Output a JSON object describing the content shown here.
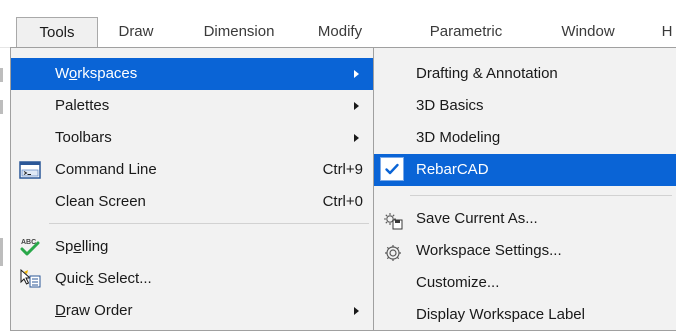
{
  "menubar": {
    "items": [
      {
        "label": "Tools"
      },
      {
        "label": "Draw"
      },
      {
        "label": "Dimension"
      },
      {
        "label": "Modify"
      },
      {
        "label": "Parametric"
      },
      {
        "label": "Window"
      },
      {
        "label": "H"
      }
    ]
  },
  "tools_menu": {
    "items": [
      {
        "pre": "W",
        "key": "o",
        "post": "rkspaces"
      },
      {
        "label": "Palettes"
      },
      {
        "label": "Toolbars"
      },
      {
        "label": "Command Line",
        "shortcut": "Ctrl+9"
      },
      {
        "label": "Clean Screen",
        "shortcut": "Ctrl+0"
      },
      {
        "pre": "Sp",
        "key": "e",
        "post": "lling"
      },
      {
        "pre": "Quic",
        "key": "k",
        "post": " Select..."
      },
      {
        "pre": "",
        "key": "D",
        "post": "raw Order"
      }
    ]
  },
  "workspaces_menu": {
    "items": [
      {
        "label": "Drafting & Annotation"
      },
      {
        "label": "3D Basics"
      },
      {
        "label": "3D Modeling"
      },
      {
        "label": "RebarCAD"
      },
      {
        "label": "Save Current As..."
      },
      {
        "label": "Workspace Settings..."
      },
      {
        "label": "Customize..."
      },
      {
        "label": "Display Workspace Label"
      }
    ]
  },
  "colors": {
    "highlight": "#0a64d6",
    "menu_bg": "#f2f2f2",
    "check": "#0a64d6"
  }
}
